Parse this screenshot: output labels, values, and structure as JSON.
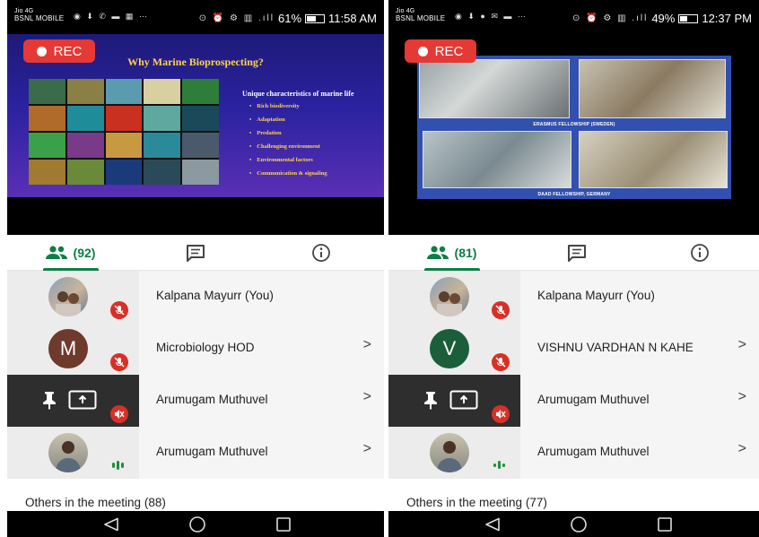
{
  "left": {
    "status": {
      "carrier1": "Jio 4G",
      "carrier2": "BSNL MOBILE",
      "battery": "61%",
      "battery_level": 0.61,
      "time": "11:58 AM"
    },
    "rec_label": "REC",
    "slide": {
      "title": "Why Marine Bioprospecting?",
      "chars_title": "Unique characteristics of marine life",
      "bullets": [
        "Rich biodiversity",
        "Adaptation",
        "Predation",
        "Challenging environment",
        "Environmental factors",
        "Communication & signaling"
      ]
    },
    "people_count": "(92)",
    "participants": [
      {
        "name": "Kalpana Mayurr (You)"
      },
      {
        "name": "Microbiology HOD",
        "initial": "M",
        "color": "#6d3a2c"
      },
      {
        "name": "Arumugam Muthuvel"
      },
      {
        "name": "Arumugam Muthuvel"
      }
    ],
    "others": "Others in the meeting (88)"
  },
  "right": {
    "status": {
      "carrier1": "Jio 4G",
      "carrier2": "BSNL MOBILE",
      "battery": "49%",
      "battery_level": 0.49,
      "time": "12:37 PM"
    },
    "rec_label": "REC",
    "slide": {
      "caption1": "ERASMUS FELLOWSHIP (SWEDEN)",
      "caption2": "DAAD FELLOWSHIP, GERMANY"
    },
    "people_count": "(81)",
    "participants": [
      {
        "name": "Kalpana Mayurr (You)"
      },
      {
        "name": "VISHNU VARDHAN N KAHE",
        "initial": "V",
        "color": "#1b5e3a"
      },
      {
        "name": "Arumugam Muthuvel"
      },
      {
        "name": "Arumugam Muthuvel"
      }
    ],
    "others": "Others in the meeting (77)"
  },
  "colors": {
    "accent": "#0b8043",
    "rec": "#e53935",
    "mic_off": "#d93025"
  }
}
